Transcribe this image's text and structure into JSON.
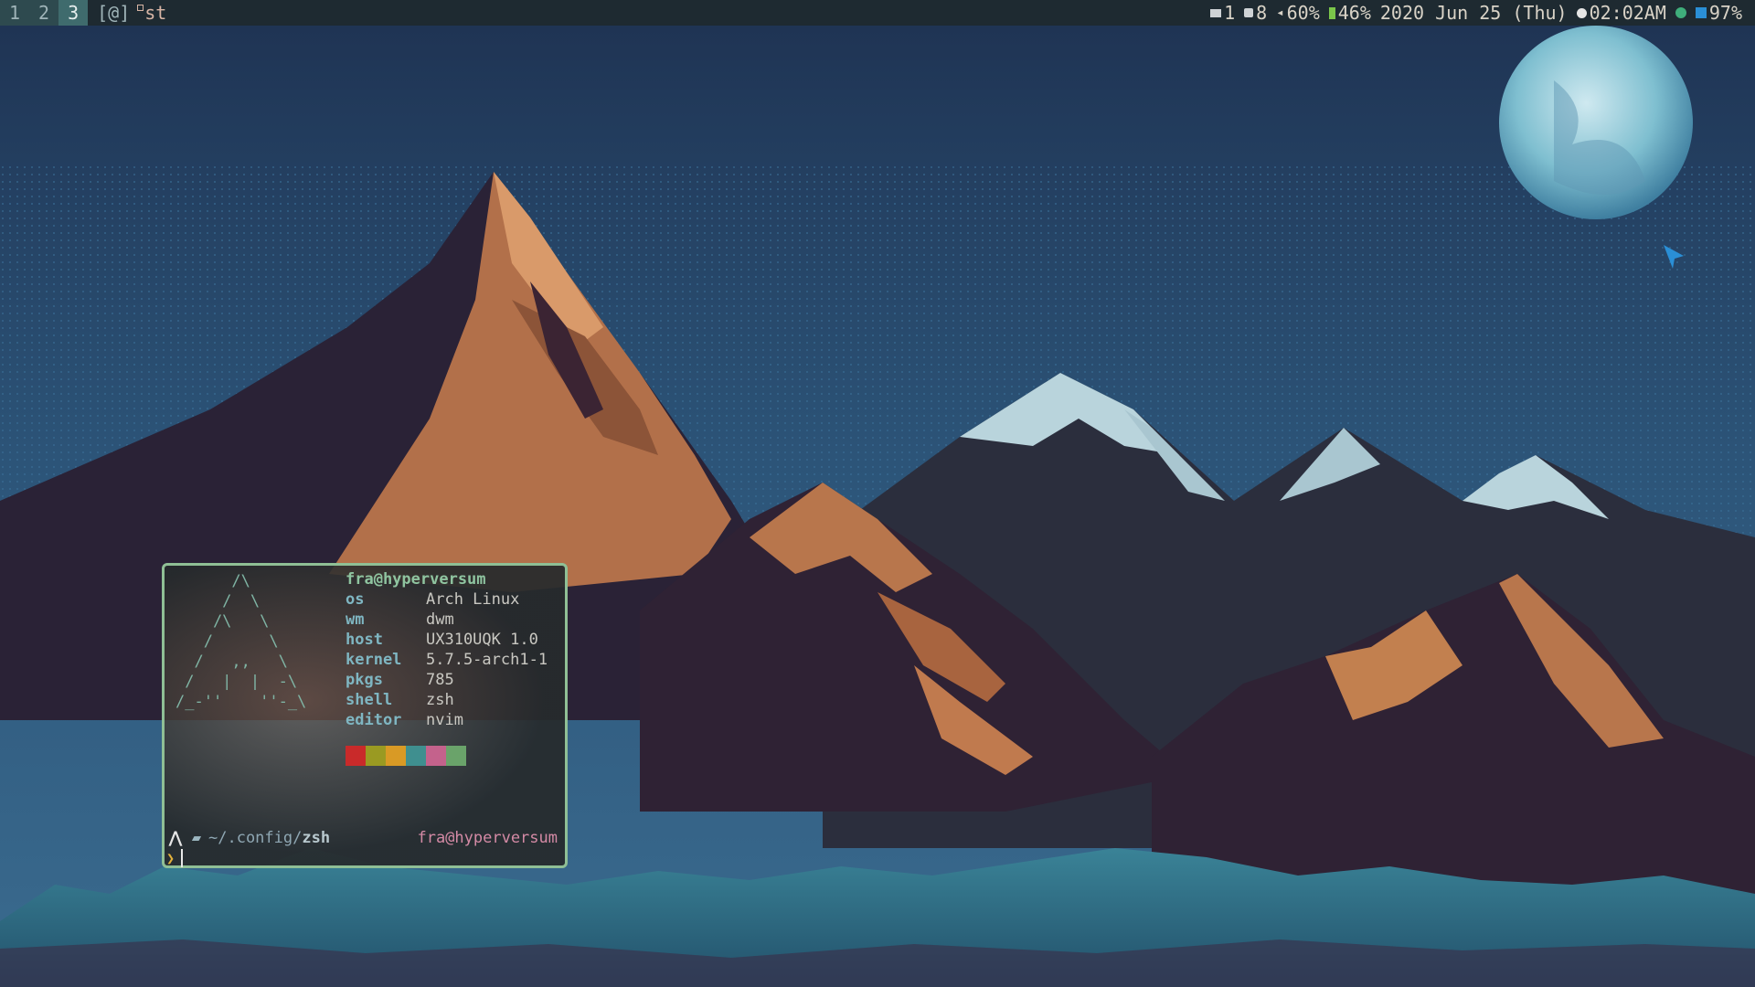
{
  "topbar": {
    "tags": [
      "1",
      "2",
      "3"
    ],
    "layout": "[@]",
    "window_title": "st",
    "status": {
      "mail": "1",
      "updates": "8",
      "volume": "60%",
      "battery": "46%",
      "date": "2020 Jun 25 (Thu)",
      "time": "02:02AM",
      "brightness": "97%"
    },
    "icons": {
      "mail": "mail-icon",
      "updates": "package-icon",
      "volume": "speaker-icon",
      "battery": "battery-icon",
      "time": "clock-icon",
      "network": "network-dot-icon",
      "brightness": "brightness-icon"
    },
    "colors": {
      "bar_bg": "#1e2a31",
      "active_tag": "#3f6b6d",
      "network_dot": "#3fae7b",
      "battery": "#7bc64a",
      "brightness": "#2a8fd6"
    }
  },
  "terminal": {
    "logo_lines": [
      "      /\\",
      "     /  \\",
      "    /\\   \\",
      "   /      \\",
      "  /   ,,   \\",
      " /   |  |  -\\",
      "/_-''    ''-_\\"
    ],
    "user_host": "fra@hyperversum",
    "info": [
      {
        "key": "os",
        "value": "Arch Linux"
      },
      {
        "key": "wm",
        "value": "dwm"
      },
      {
        "key": "host",
        "value": "UX310UQK 1.0"
      },
      {
        "key": "kernel",
        "value": "5.7.5-arch1-1"
      },
      {
        "key": "pkgs",
        "value": "785"
      },
      {
        "key": "shell",
        "value": "zsh"
      },
      {
        "key": "editor",
        "value": "nvim"
      }
    ],
    "palette": [
      "#c92a2a",
      "#9a9a22",
      "#d99a25",
      "#3f8f8f",
      "#c4628c",
      "#6aa36a"
    ],
    "prompt": {
      "path_prefix": "~/.config/",
      "path_dir": "zsh",
      "right_user": "fra@hyperversum"
    },
    "border_color": "#8fbf95"
  },
  "wallpaper": {
    "sky_top": "#1f3454",
    "sky_bottom": "#3a6b8f",
    "mountain_dark": "#2a2236",
    "rock_orange": "#b2704a",
    "snow": "#b9d4dc",
    "forest": "#2f6e80"
  }
}
